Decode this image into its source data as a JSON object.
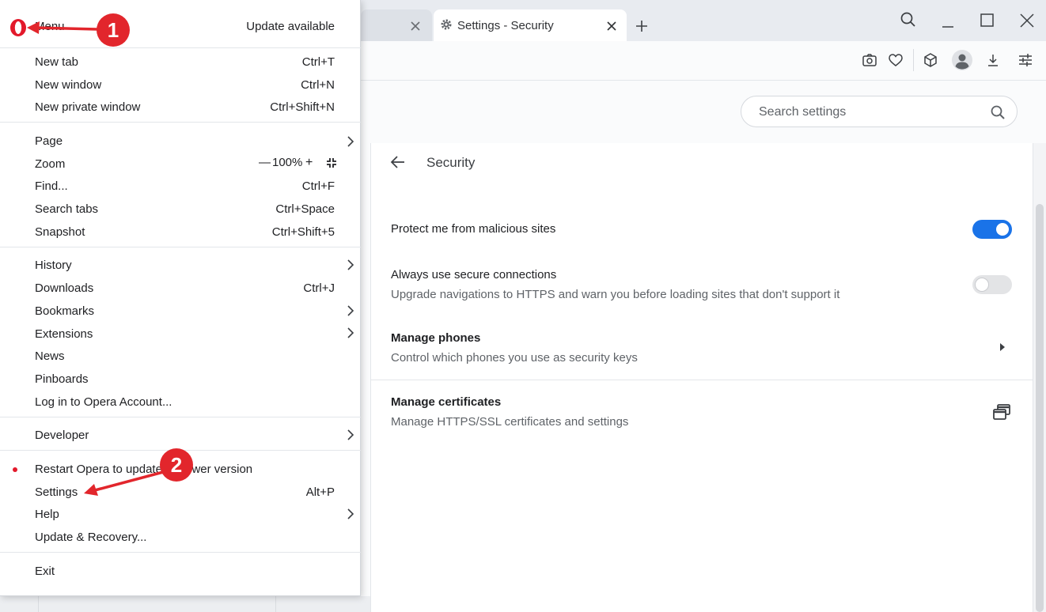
{
  "tabs": {
    "active_title": "Settings - Security"
  },
  "search": {
    "placeholder": "Search settings"
  },
  "security": {
    "heading": "Security",
    "rows": [
      {
        "title": "Protect me from malicious sites",
        "toggle": true
      },
      {
        "title": "Always use secure connections",
        "subtitle": "Upgrade navigations to HTTPS and warn you before loading sites that don't support it",
        "toggle": false
      },
      {
        "title": "Manage phones",
        "subtitle": "Control which phones you use as security keys"
      },
      {
        "title": "Manage certificates",
        "subtitle": "Manage HTTPS/SSL certificates and settings"
      }
    ]
  },
  "menu": {
    "title": "Menu",
    "update_available": "Update available",
    "items": {
      "new_tab": {
        "label": "New tab",
        "shortcut": "Ctrl+T"
      },
      "new_window": {
        "label": "New window",
        "shortcut": "Ctrl+N"
      },
      "new_private_window": {
        "label": "New private window",
        "shortcut": "Ctrl+Shift+N"
      },
      "page": {
        "label": "Page"
      },
      "zoom": {
        "label": "Zoom",
        "minus": "—",
        "level": "100%",
        "plus": "+"
      },
      "find": {
        "label": "Find...",
        "shortcut": "Ctrl+F"
      },
      "search_tabs": {
        "label": "Search tabs",
        "shortcut": "Ctrl+Space"
      },
      "snapshot": {
        "label": "Snapshot",
        "shortcut": "Ctrl+Shift+5"
      },
      "history": {
        "label": "History"
      },
      "downloads": {
        "label": "Downloads",
        "shortcut": "Ctrl+J"
      },
      "bookmarks": {
        "label": "Bookmarks"
      },
      "extensions": {
        "label": "Extensions"
      },
      "news": {
        "label": "News"
      },
      "pinboards": {
        "label": "Pinboards"
      },
      "login": {
        "label": "Log in to Opera Account..."
      },
      "developer": {
        "label": "Developer"
      },
      "restart": {
        "label": "Restart Opera to update to newer version"
      },
      "settings": {
        "label": "Settings",
        "shortcut": "Alt+P"
      },
      "help": {
        "label": "Help"
      },
      "update_recovery": {
        "label": "Update & Recovery..."
      },
      "exit": {
        "label": "Exit"
      }
    }
  },
  "annotations": {
    "step1": "1",
    "step2": "2",
    "color": "#e2262c"
  },
  "colors": {
    "toggle_on": "#1a73e8",
    "opera_red": "#e3192b",
    "restart_dot": "#e3192b"
  },
  "icons": [
    "opera-logo-icon",
    "gear-icon",
    "close-icon",
    "plus-icon",
    "search-icon",
    "minimize-icon",
    "maximize-icon",
    "camera-icon",
    "heart-icon",
    "cube-icon",
    "avatar-icon",
    "download-icon",
    "easy-setup-icon",
    "back-arrow-icon",
    "chevron-right-icon",
    "external-window-icon",
    "fullscreen-icon"
  ]
}
